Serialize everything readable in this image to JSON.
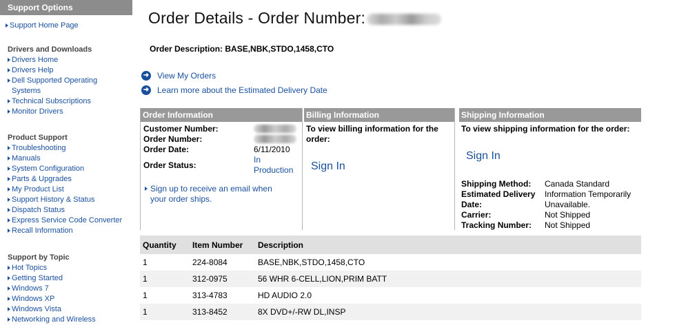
{
  "sidebar": {
    "header": "Support Options",
    "home": "Support Home Page",
    "sections": [
      {
        "title": "Drivers and Downloads",
        "items": [
          "Drivers Home",
          "Drivers Help",
          "Dell Supported Operating Systems",
          "Technical Subscriptions",
          "Monitor Drivers"
        ]
      },
      {
        "title": "Product Support",
        "items": [
          "Troubleshooting",
          "Manuals",
          "System Configuration",
          "Parts & Upgrades",
          "My Product List",
          "Support History & Status",
          "Dispatch Status",
          "Express Service Code Converter",
          "Recall Information"
        ]
      },
      {
        "title": "Support by Topic",
        "items": [
          "Hot Topics",
          "Getting Started",
          "Windows 7",
          "Windows XP",
          "Windows Vista",
          "Networking and Wireless"
        ]
      }
    ]
  },
  "page": {
    "title": "Order Details - Order Number:",
    "desc_label": "Order Description:",
    "desc_value": "BASE,NBK,STDO,1458,CTO",
    "links": [
      "View My Orders",
      "Learn more about the Estimated Delivery Date"
    ]
  },
  "order_info": {
    "header": "Order Information",
    "customer_label": "Customer Number:",
    "order_label": "Order Number:",
    "date_label": "Order Date:",
    "date_value": "6/11/2010",
    "status_label": "Order Status:",
    "status_value": "In Production",
    "signup_link": "Sign up to receive an email when your order ships."
  },
  "billing": {
    "header": "Billing Information",
    "text": "To view billing information for the order:",
    "signin": "Sign In"
  },
  "shipping": {
    "header": "Shipping Information",
    "text": "To view shipping information for the order:",
    "signin": "Sign In",
    "method_label": "Shipping Method:",
    "method_value": "Canada Standard",
    "delivery_label": "Estimated Delivery Date:",
    "delivery_value": "Information Temporarily Unavailable.",
    "carrier_label": "Carrier:",
    "carrier_value": "Not Shipped",
    "tracking_label": "Tracking Number:",
    "tracking_value": "Not Shipped"
  },
  "items_table": {
    "headers": [
      "Quantity",
      "Item Number",
      "Description"
    ],
    "rows": [
      [
        "1",
        "224-8084",
        "BASE,NBK,STDO,1458,CTO"
      ],
      [
        "1",
        "312-0975",
        "56 WHR 6-CELL,LION,PRIM BATT"
      ],
      [
        "1",
        "313-4783",
        "HD AUDIO 2.0"
      ],
      [
        "1",
        "313-8452",
        "8X DVD+/-RW DL,INSP"
      ]
    ]
  },
  "colors": {
    "link": "#1a4f9c",
    "panel_header": "#999999",
    "sidebar_header": "#8c8c8c"
  }
}
